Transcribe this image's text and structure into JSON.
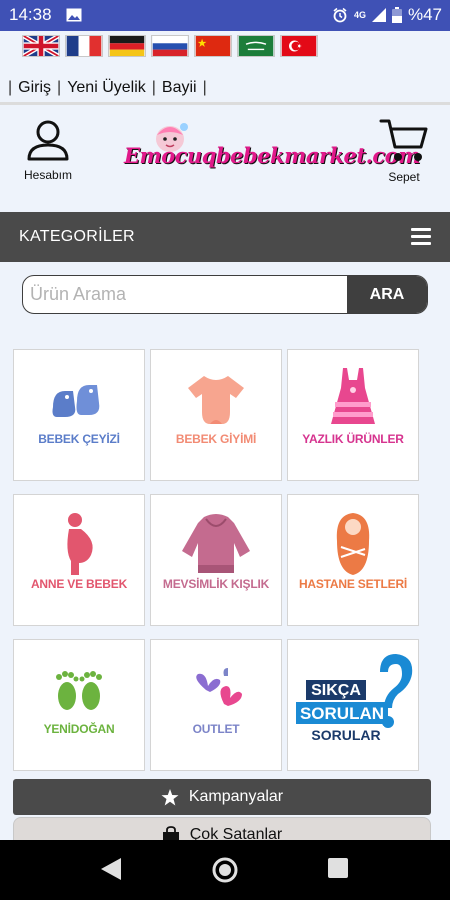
{
  "status": {
    "time": "14:38",
    "network": "4G",
    "battery": "%47"
  },
  "flags": [
    "uk-flag",
    "france-flag",
    "germany-flag",
    "russia-flag",
    "china-flag",
    "saudi-flag",
    "turkey-flag"
  ],
  "top_links": {
    "login": "Giriş",
    "register": "Yeni Üyelik",
    "dealer": "Bayii",
    "sep": "|"
  },
  "header": {
    "account_label": "Hesabım",
    "logo_text": "Emocuqbebekmarket.com",
    "cart_label": "Sepet"
  },
  "categories_bar": {
    "title": "KATEGORİLER"
  },
  "search": {
    "placeholder": "Ürün Arama",
    "button": "ARA"
  },
  "categories": [
    {
      "label": "BEBEK ÇEYİZİ",
      "color": "#5b7dc9"
    },
    {
      "label": "BEBEK GİYİMİ",
      "color": "#f28b74"
    },
    {
      "label": "YAZLIK ÜRÜNLER",
      "color": "#d6348f"
    },
    {
      "label": "ANNE VE BEBEK",
      "color": "#e2566e"
    },
    {
      "label": "MEVSİMLİK KIŞLIK",
      "color": "#c46b8f"
    },
    {
      "label": "HASTANE SETLERİ",
      "color": "#ec7a45"
    },
    {
      "label": "YENİDOĞAN",
      "color": "#6cb33f"
    },
    {
      "label": "OUTLET",
      "color": "#7c84c8"
    },
    {
      "label": "SIKÇA SORULAN SORULAR",
      "line1": "SIKÇA",
      "line2": "SORULAN",
      "line3": "SORULAR",
      "color": "#1a8ad4"
    }
  ],
  "bars": {
    "campaigns": "Kampanyalar",
    "bestsellers": "Çok Satanlar"
  }
}
